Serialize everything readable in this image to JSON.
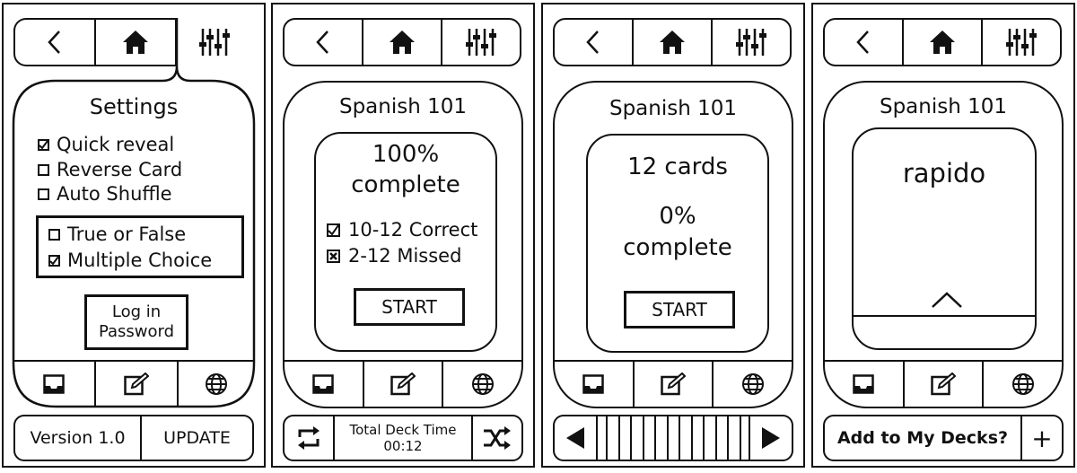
{
  "panels": [
    {
      "title": "Settings",
      "options": [
        {
          "label": "Quick reveal",
          "checked": true
        },
        {
          "label": "Reverse Card",
          "checked": false
        },
        {
          "label": "Auto Shuffle",
          "checked": false
        }
      ],
      "mode_options": [
        {
          "label": "True or False",
          "checked": false
        },
        {
          "label": "Multiple Choice",
          "checked": true
        }
      ],
      "login_line1": "Log in",
      "login_line2": "Password",
      "version": "Version 1.0",
      "update": "UPDATE"
    },
    {
      "title": "Spanish 101",
      "percent": "100%",
      "complete": "complete",
      "correct": "10-12 Correct",
      "missed": "2-12 Missed",
      "start": "START",
      "deck_time_label": "Total Deck Time",
      "deck_time": "00:12"
    },
    {
      "title": "Spanish 101",
      "cards": "12 cards",
      "percent": "0%",
      "complete": "complete",
      "start": "START"
    },
    {
      "title": "Spanish 101",
      "word": "rapido",
      "add_decks": "Add to My Decks?",
      "plus": "+"
    }
  ],
  "icons": [
    "back-icon",
    "home-icon",
    "sliders-icon",
    "inbox-icon",
    "edit-icon",
    "globe-icon",
    "repeat-icon",
    "shuffle-icon",
    "play-left-icon",
    "play-right-icon",
    "chevron-up-icon",
    "checkbox-icon"
  ]
}
